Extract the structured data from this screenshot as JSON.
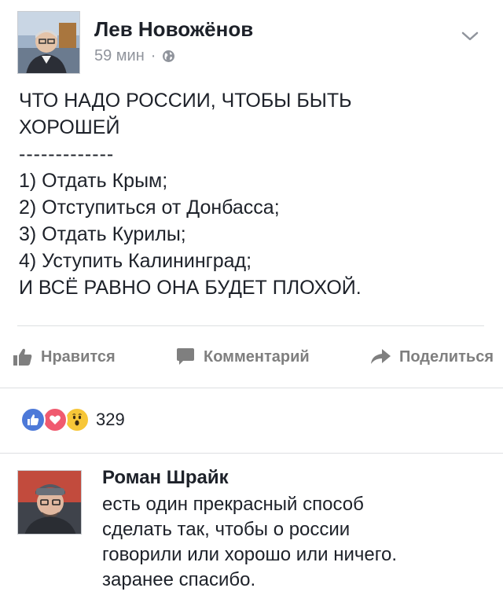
{
  "post": {
    "author": "Лев Новожёнов",
    "time": "59 мин",
    "dot": "·",
    "privacy_icon": "globe-icon",
    "menu_icon": "chevron-down-icon",
    "lines": [
      "ЧТО НАДО РОССИИ, ЧТОБЫ БЫТЬ",
      "ХОРОШЕЙ",
      "-------------",
      "1) Отдать Крым;",
      "2) Отступиться от Донбасса;",
      "3) Отдать Курилы;",
      "4) Уступить Калининград;",
      "И ВСЁ РАВНО ОНА БУДЕТ ПЛОХОЙ."
    ]
  },
  "actions": {
    "like": "Нравится",
    "comment": "Комментарий",
    "share": "Поделиться"
  },
  "reactions": {
    "types": [
      "like",
      "love",
      "wow"
    ],
    "count": "329"
  },
  "comment": {
    "author": "Роман Шрайк",
    "lines": [
      "есть один прекрасный способ",
      "сделать так, чтобы о россии",
      "говорили или хорошо или ничего.",
      "заранее спасибо."
    ]
  },
  "colors": {
    "text": "#1d2129",
    "meta": "#90949c",
    "action": "#7f7f7f",
    "like_blue": "#4d79d8",
    "love_red": "#f05a6f",
    "wow_yellow": "#f7c638"
  }
}
